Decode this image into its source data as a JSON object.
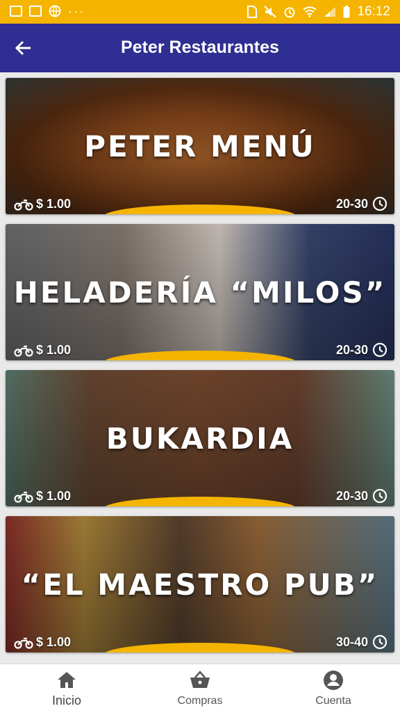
{
  "status_bar": {
    "time": "16:12",
    "left_icons": [
      "screen-icon",
      "gallery-icon",
      "globe-icon"
    ],
    "more": "···",
    "right_icons": [
      "sim-icon",
      "mute-icon",
      "alarm-icon",
      "wifi-icon",
      "signal-icon",
      "battery-icon"
    ],
    "color": "#f4b400"
  },
  "app_bar": {
    "title": "Peter Restaurantes",
    "color": "#2e2e93"
  },
  "restaurants": [
    {
      "name": "PETER MENÚ",
      "delivery": "$ 1.00",
      "time": "20-30"
    },
    {
      "name": "HELADERÍA “MILOS”",
      "delivery": "$ 1.00",
      "time": "20-30"
    },
    {
      "name": "BUKARDIA",
      "delivery": "$ 1.00",
      "time": "20-30"
    },
    {
      "name": "“EL MAESTRO PUB”",
      "delivery": "$ 1.00",
      "time": "30-40"
    }
  ],
  "bottom_nav": {
    "items": [
      {
        "label": "Inicio",
        "icon": "home-icon",
        "active": true
      },
      {
        "label": "Compras",
        "icon": "basket-icon",
        "active": false
      },
      {
        "label": "Cuenta",
        "icon": "account-icon",
        "active": false
      }
    ]
  },
  "colors": {
    "accent": "#f4b400",
    "primary": "#2e2e93"
  }
}
